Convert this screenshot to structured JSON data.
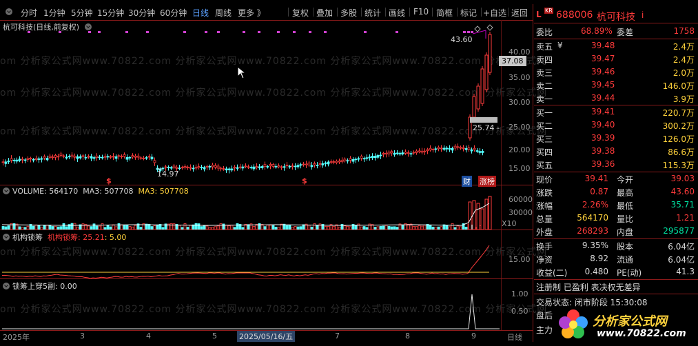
{
  "toolbar": {
    "periods": [
      "分时",
      "1分钟",
      "5分钟",
      "15分钟",
      "30分钟",
      "60分钟",
      "日线",
      "周线",
      "更多 》"
    ],
    "active_period": "日线",
    "tools": [
      "复权",
      "叠加",
      "多股",
      "统计",
      "画线",
      "F10",
      "简框",
      "标记",
      "+自选",
      "返回"
    ]
  },
  "chart": {
    "title": "杭可科技(日线,前复权)",
    "y_ticks": [
      "40.00",
      "35.00",
      "30.00",
      "25.00",
      "20.00",
      "15.00"
    ],
    "price_tag": "37.08",
    "high_label": "43.60",
    "mark_label": "25.74 -",
    "low_label": "14.97",
    "badge_cai": "财",
    "badge_zb": "涨榜",
    "marker": "$"
  },
  "volume": {
    "label": "VOLUME: 564170",
    "ma_label": "MA3: 507708",
    "ma_label2": "MA3: 507708",
    "y_ticks": [
      "60000",
      "30000",
      "X10"
    ]
  },
  "jgcm": {
    "label": "机构锁筹",
    "value": "机构锁筹: 25.21",
    "value2": ": 5.00",
    "y_ticks": [
      "15.00"
    ]
  },
  "scpc": {
    "label": "锁筹上穿5副",
    "value": ": 0.00",
    "y_ticks": [
      "1.00",
      "0.50"
    ]
  },
  "xaxis": {
    "labels": [
      "2025年",
      "3",
      "4",
      "5",
      "2025/05/16/五",
      "7",
      "8",
      "9"
    ],
    "period": "日线"
  },
  "watermark": {
    "text": "om 分析家公式网www.70822.com 分析家公式网www.70822.com 分析家公式网www.70822.com 分析家公式网"
  },
  "quote": {
    "code": "688006",
    "name": "杭可科技",
    "weibi_label": "委比",
    "weibi": "68.89%",
    "weicha_label": "委差",
    "weicha": "1758",
    "sell": [
      {
        "label": "卖五",
        "sym": "¥",
        "price": "39.48",
        "vol": "2.4万"
      },
      {
        "label": "卖四",
        "sym": "",
        "price": "39.47",
        "vol": "2.4万"
      },
      {
        "label": "卖三",
        "sym": "",
        "price": "39.46",
        "vol": "2.0万"
      },
      {
        "label": "卖二",
        "sym": "",
        "price": "39.45",
        "vol": "146.0万"
      },
      {
        "label": "卖一",
        "sym": "",
        "price": "39.44",
        "vol": "3.9万"
      }
    ],
    "buy": [
      {
        "label": "买一",
        "price": "39.41",
        "vol": "220.7万"
      },
      {
        "label": "买二",
        "price": "39.40",
        "vol": "300.2万"
      },
      {
        "label": "买三",
        "price": "39.39",
        "vol": "126.0万"
      },
      {
        "label": "买四",
        "price": "39.38",
        "vol": "86.6万"
      },
      {
        "label": "买五",
        "price": "39.36",
        "vol": "115.3万"
      }
    ],
    "stats": [
      {
        "l1": "现价",
        "v1": "39.41",
        "c1": "red",
        "l2": "今开",
        "v2": "39.03",
        "c2": "red"
      },
      {
        "l1": "涨跌",
        "v1": "0.87",
        "c1": "red",
        "l2": "最高",
        "v2": "43.60",
        "c2": "red"
      },
      {
        "l1": "涨幅",
        "v1": "2.26%",
        "c1": "red",
        "l2": "最低",
        "v2": "35.71",
        "c2": "green"
      },
      {
        "l1": "总量",
        "v1": "564170",
        "c1": "yellow",
        "l2": "量比",
        "v2": "1.21",
        "c2": "red"
      },
      {
        "l1": "外盘",
        "v1": "268293",
        "c1": "red",
        "l2": "内盘",
        "v2": "295877",
        "c2": "green"
      }
    ],
    "stats2": [
      {
        "l1": "换手",
        "v1": "9.35%",
        "l2": "股本",
        "v2": "6.04亿"
      },
      {
        "l1": "净资",
        "v1": "8.92",
        "l2": "流通",
        "v2": "6.04亿"
      },
      {
        "l1": "收益(二)",
        "v1": "0.480",
        "l2": "PE(动)",
        "v2": "41.3"
      }
    ],
    "note": "注册制 已盈利 表决权无差异",
    "status": "交易状态: 闭市阶段 15:30:08",
    "pan_hou": "盘后",
    "zhu_li": "主力"
  },
  "logo": {
    "name": "分析家公式网",
    "url": "www.70822.com"
  }
}
